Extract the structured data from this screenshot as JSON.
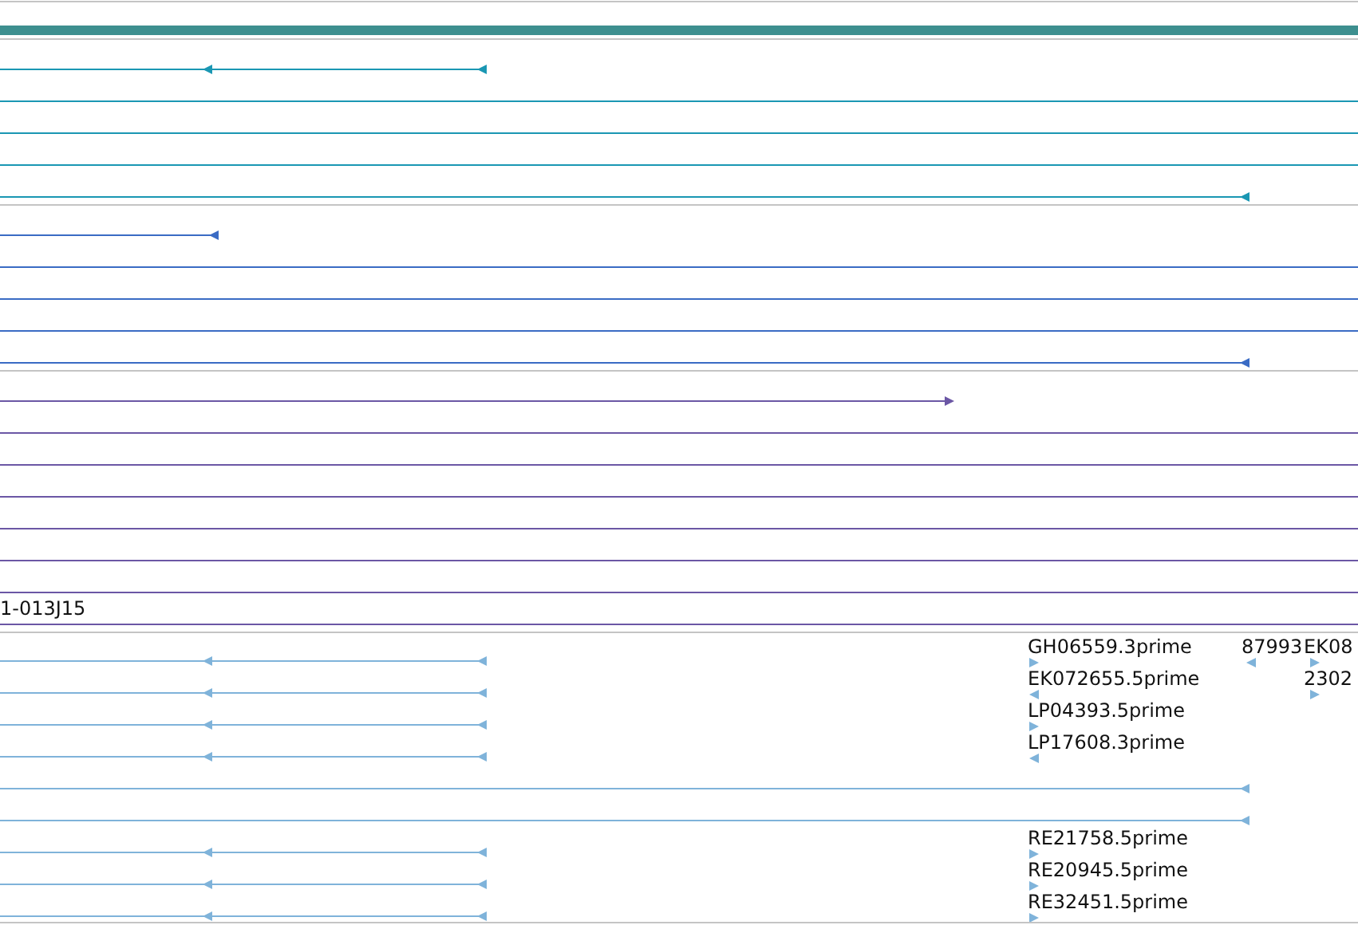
{
  "tracks": [
    {
      "color": "#1a97b3",
      "rows": [
        {
          "kind": "intron"
        },
        {
          "kind": "plain"
        },
        {
          "kind": "plain"
        },
        {
          "kind": "plain"
        },
        {
          "kind": "long"
        }
      ]
    },
    {
      "color": "#3a6bc4",
      "rows": [
        {
          "kind": "short"
        },
        {
          "kind": "plain"
        },
        {
          "kind": "plain"
        },
        {
          "kind": "plain"
        },
        {
          "kind": "long"
        }
      ]
    },
    {
      "color": "#6b57a5",
      "label": "1-013J15",
      "rows": [
        {
          "kind": "forward"
        },
        {
          "kind": "plain"
        },
        {
          "kind": "plain"
        },
        {
          "kind": "plain"
        },
        {
          "kind": "plain"
        },
        {
          "kind": "plain"
        },
        {
          "kind": "plain"
        },
        {
          "kind": "plain"
        }
      ]
    },
    {
      "color": "#7fb3da",
      "rows": [
        {
          "kind": "intron",
          "tag": {
            "text": "GH06559.3prime",
            "kind": "forward"
          }
        },
        {
          "kind": "intron",
          "tag": {
            "text": "EK072655.5prime",
            "kind": "reverse"
          }
        },
        {
          "kind": "intron",
          "tag": {
            "text": "LP04393.5prime",
            "kind": "forward"
          }
        },
        {
          "kind": "intron",
          "tag": {
            "text": "LP17608.3prime",
            "kind": "reverse"
          }
        },
        {
          "kind": "long"
        },
        {
          "kind": "long"
        },
        {
          "kind": "intron",
          "tag": {
            "text": "RE21758.5prime",
            "kind": "forward"
          }
        },
        {
          "kind": "intron",
          "tag": {
            "text": "RE20945.5prime",
            "kind": "forward"
          }
        },
        {
          "kind": "intron",
          "tag": {
            "text": "RE32451.5prime",
            "kind": "forward"
          }
        }
      ],
      "column_b": [
        {
          "text": "87993",
          "kind": "reverse"
        }
      ],
      "column_c": [
        {
          "text": "EK08",
          "kind": "forward"
        },
        {
          "text": "2302",
          "kind": "forward"
        }
      ]
    }
  ]
}
